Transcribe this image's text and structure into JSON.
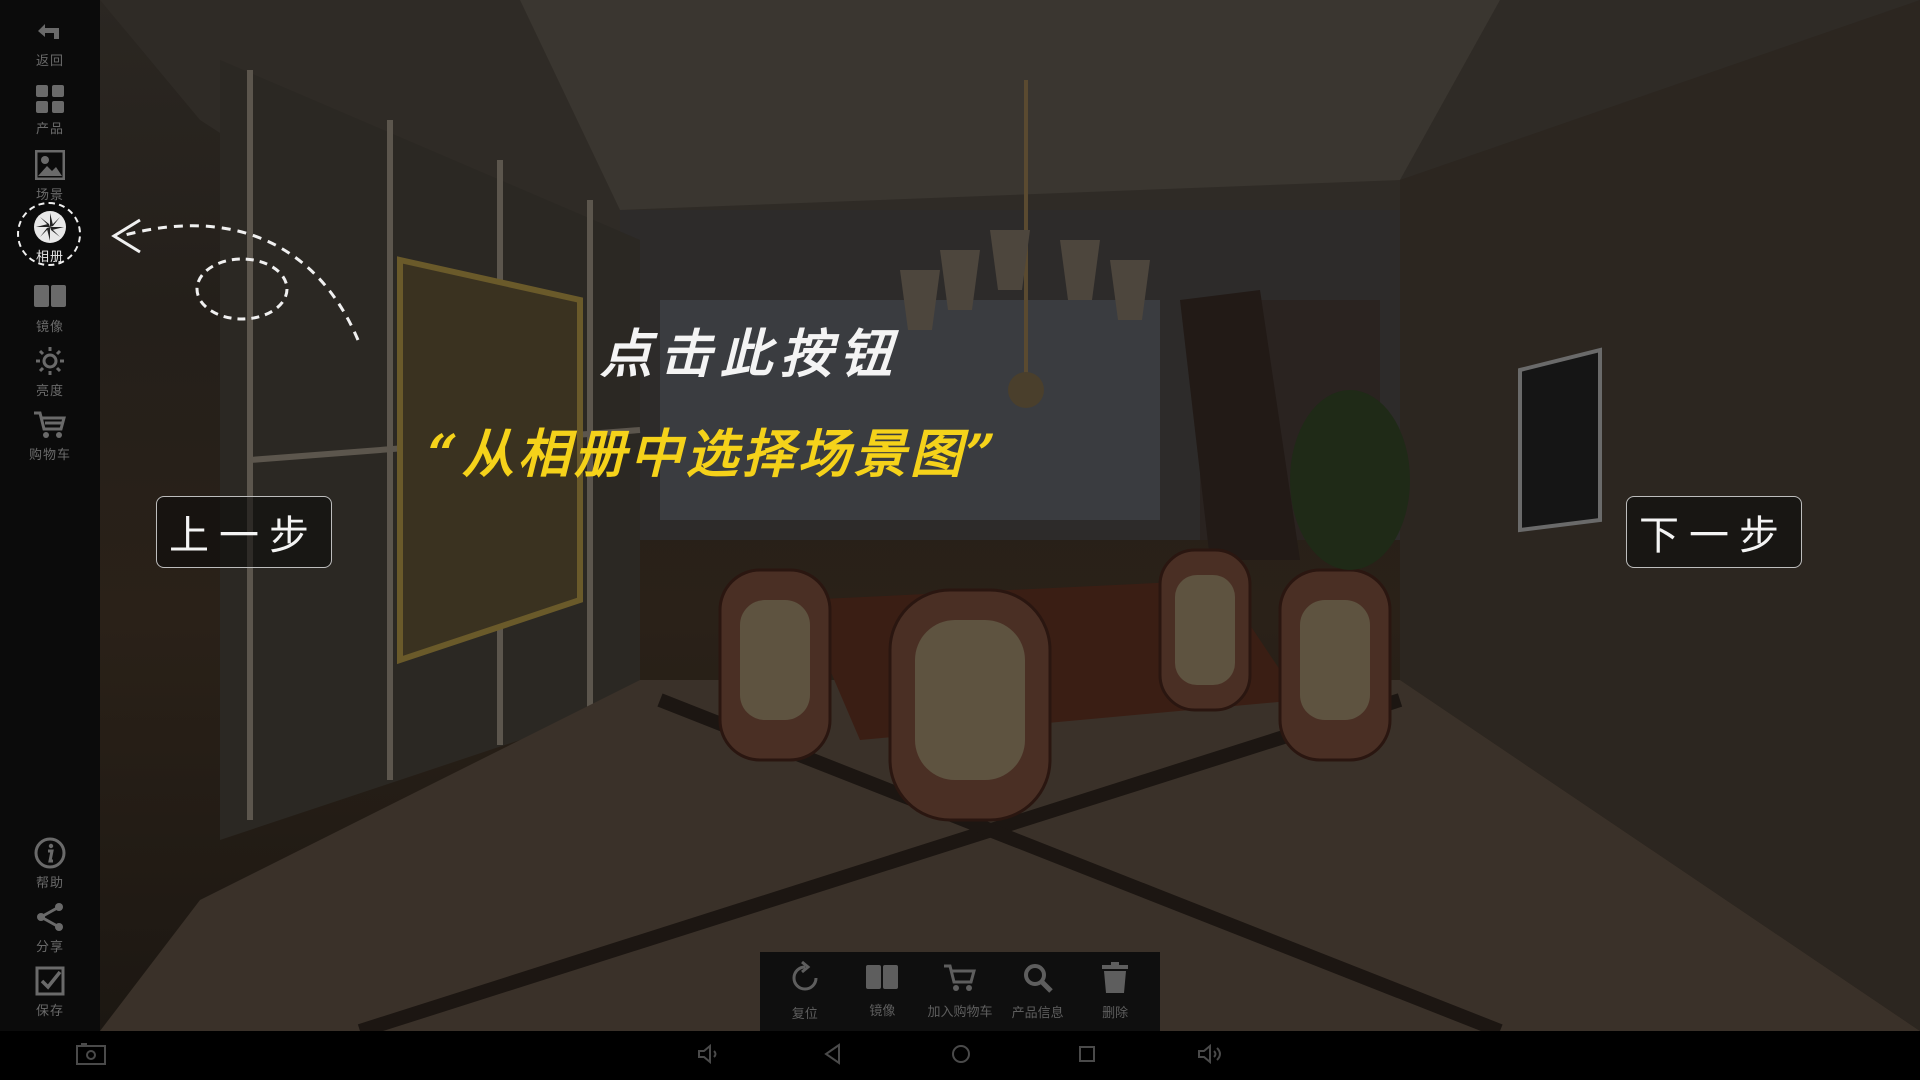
{
  "sidebar": {
    "items": [
      {
        "label": "返回",
        "icon": "back-arrow-icon"
      },
      {
        "label": "产品",
        "icon": "grid-icon"
      },
      {
        "label": "场景",
        "icon": "image-icon"
      },
      {
        "label": "相册",
        "icon": "album-aperture-icon",
        "active": true
      },
      {
        "label": "镜像",
        "icon": "mirror-book-icon"
      },
      {
        "label": "亮度",
        "icon": "brightness-sun-icon"
      },
      {
        "label": "购物车",
        "icon": "cart-icon"
      },
      {
        "label": "帮助",
        "icon": "info-icon"
      },
      {
        "label": "分享",
        "icon": "share-icon"
      },
      {
        "label": "保存",
        "icon": "save-check-icon"
      }
    ]
  },
  "guide": {
    "line1": "点击此按钮",
    "line2": "“从相册中选择场景图”",
    "prev_label": "上一步",
    "next_label": "下一步",
    "accent_color": "#f5d21a"
  },
  "toolbar": {
    "items": [
      {
        "label": "复位",
        "icon": "reset-icon"
      },
      {
        "label": "镜像",
        "icon": "mirror-book-icon"
      },
      {
        "label": "加入购物车",
        "icon": "cart-icon"
      },
      {
        "label": "产品信息",
        "icon": "search-icon"
      },
      {
        "label": "删除",
        "icon": "trash-icon"
      }
    ]
  },
  "navbar": {
    "icons": [
      "screenshot-icon",
      "volume-down-icon",
      "back-icon",
      "home-icon",
      "recents-icon",
      "volume-up-icon"
    ]
  }
}
